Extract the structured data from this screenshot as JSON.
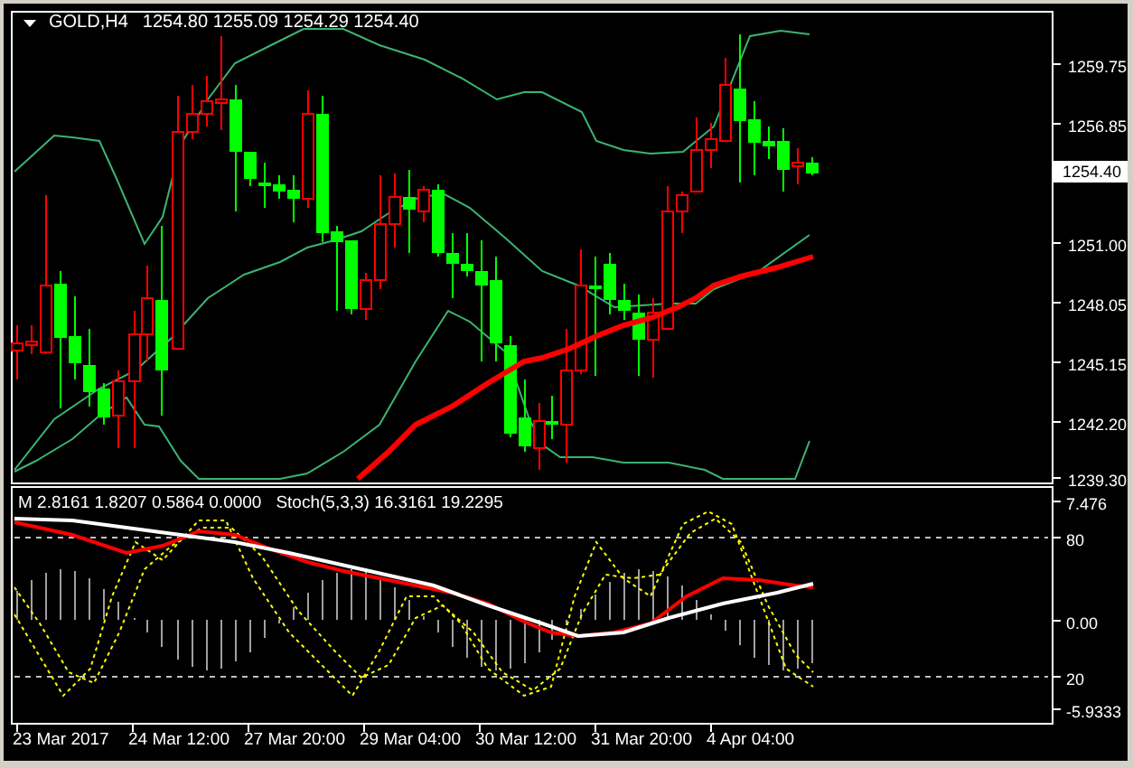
{
  "main_chart": {
    "header": {
      "symbol": "GOLD,H4",
      "ohlc": "1254.80 1255.09 1254.29 1254.40"
    },
    "price_labels": [
      "1259.75",
      "1256.85",
      "1251.00",
      "1248.05",
      "1245.15",
      "1242.20",
      "1239.30"
    ],
    "current_price": "1254.40"
  },
  "indicator_panel": {
    "legend": [
      "M 2.8161 1.8207 0.5864 0.0000",
      "Stoch(5,3,3) 16.3161 19.2295"
    ],
    "scale_labels": [
      "7.476",
      "80",
      "0.00",
      "20",
      "-5.9333"
    ]
  },
  "time_axis": {
    "labels": [
      "23 Mar 2017",
      "24 Mar 12:00",
      "27 Mar 20:00",
      "29 Mar 04:00",
      "30 Mar 12:00",
      "31 Mar 20:00",
      "4 Apr 04:00"
    ]
  }
}
